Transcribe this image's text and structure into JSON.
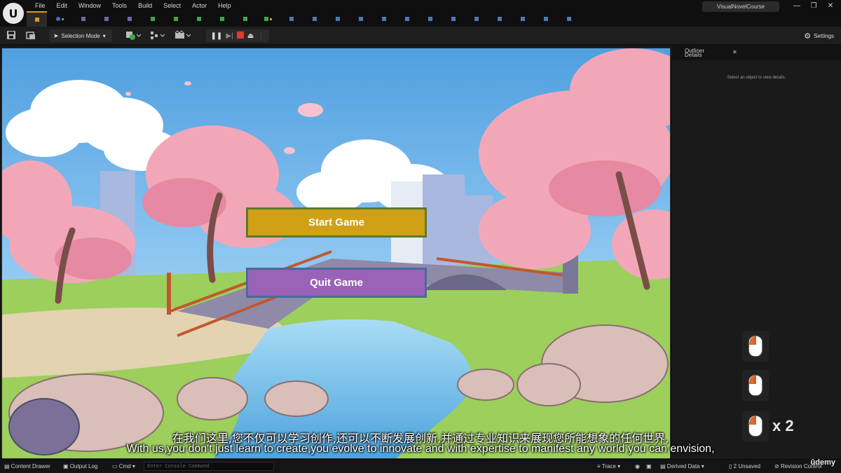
{
  "menu": [
    "File",
    "Edit",
    "Window",
    "Tools",
    "Build",
    "Select",
    "Actor",
    "Help"
  ],
  "project_title": "VisualNovelCourse",
  "window_controls": [
    "—",
    "❐",
    "✕"
  ],
  "toolbar": {
    "selection_mode": "Selection Mode",
    "settings": "Settings"
  },
  "viewport": {
    "start_button": "Start Game",
    "quit_button": "Quit Game"
  },
  "right_panel": {
    "tab_outliner": "Outliner",
    "tab_details": "Details",
    "close": "✕",
    "empty_message": "Select an object to view details.",
    "mouse_count": "x 2"
  },
  "subtitles": {
    "cn": "在我们这里,您不仅可以学习创作,还可以不断发展创新,并通过专业知识来展现您所能想象的任何世界,",
    "en": "With us,you don't just learn to create,you evolve to innovate and with expertise to manifest any world you can envision,"
  },
  "statusbar": {
    "content_drawer": "Content Drawer",
    "output_log": "Output Log",
    "cmd": "Cmd",
    "console_placeholder": "Enter Console Command",
    "trace": "Trace",
    "derived_data": "Derived Data",
    "unsaved": "2 Unsaved",
    "revision_control": "Revision Control",
    "brand": "ûdemy"
  },
  "colors": {
    "accent_tab": "#d69a1e",
    "start_button": "#d0a116",
    "quit_button": "#9a63b8",
    "play_stop": "#e03a2a"
  }
}
